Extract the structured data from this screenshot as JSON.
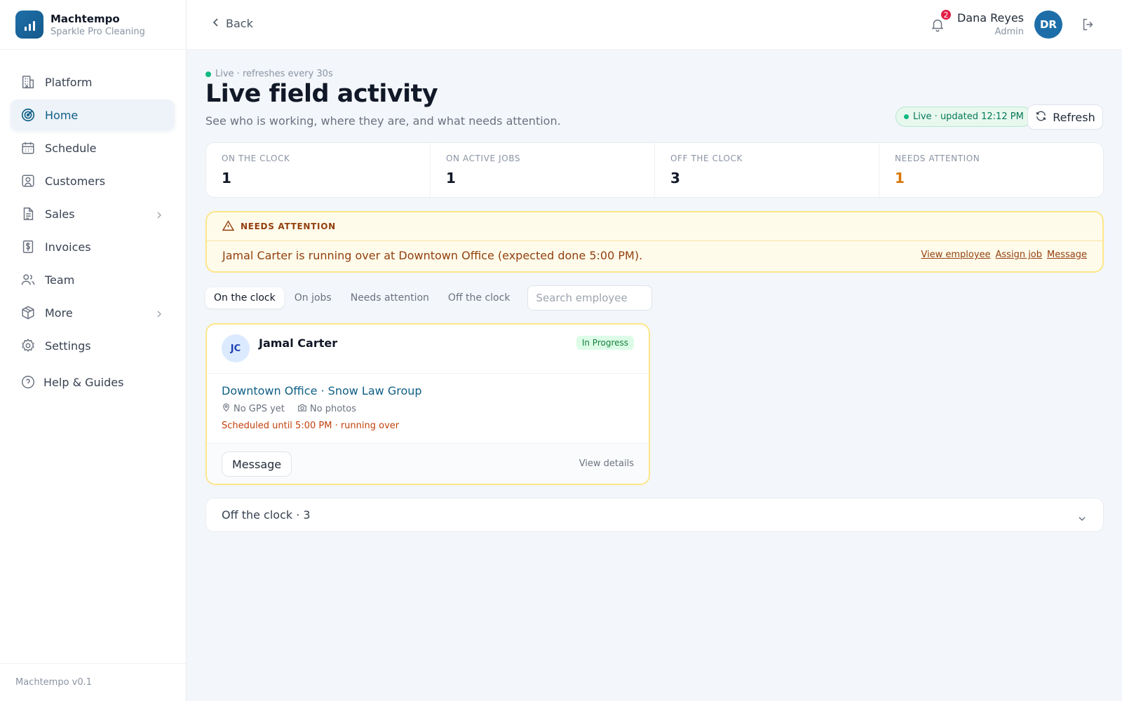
{
  "brand": {
    "name": "Machtempo",
    "subtitle": "Sparkle Pro Cleaning"
  },
  "sidebar": {
    "items": [
      {
        "label": "Platform",
        "icon": "building-icon",
        "active": false
      },
      {
        "label": "Home",
        "icon": "radar-icon",
        "active": true
      },
      {
        "label": "Schedule",
        "icon": "calendar-icon",
        "active": false
      },
      {
        "label": "Customers",
        "icon": "user-square-icon",
        "active": false
      },
      {
        "label": "Sales",
        "icon": "document-icon",
        "active": false,
        "expandable": true
      },
      {
        "label": "Invoices",
        "icon": "dollar-receipt-icon",
        "active": false
      },
      {
        "label": "Team",
        "icon": "users-icon",
        "active": false
      },
      {
        "label": "More",
        "icon": "package-icon",
        "active": false,
        "expandable": true
      },
      {
        "label": "Settings",
        "icon": "gear-icon",
        "active": false
      },
      {
        "label": "Help & Guides",
        "icon": "help-circle-icon",
        "active": false
      }
    ],
    "version": "Machtempo v0.1"
  },
  "header": {
    "back_label": "Back",
    "notifications_count": "2",
    "user_name": "Dana Reyes",
    "user_role": "Admin",
    "user_initials": "DR"
  },
  "page": {
    "live_status": "Live · refreshes every 30s",
    "title": "Live field activity",
    "subtitle": "See who is working, where they are, and what needs attention.",
    "live_pill": "Live · updated 12:12 PM",
    "refresh_label": "Refresh"
  },
  "stats": [
    {
      "label": "ON THE CLOCK",
      "value": "1"
    },
    {
      "label": "ON ACTIVE JOBS",
      "value": "1"
    },
    {
      "label": "OFF THE CLOCK",
      "value": "3"
    },
    {
      "label": "NEEDS ATTENTION",
      "value": "1"
    }
  ],
  "alert": {
    "heading": "NEEDS ATTENTION",
    "message": "Jamal Carter is running over at Downtown Office (expected done 5:00 PM).",
    "links": [
      "View employee",
      "Assign job",
      "Message"
    ]
  },
  "filters": {
    "tabs": [
      "On the clock",
      "On jobs",
      "Needs attention",
      "Off the clock"
    ],
    "active_tab": "On the clock",
    "search_placeholder": "Search employee"
  },
  "employee_card": {
    "initials": "JC",
    "name": "Jamal Carter",
    "status": "In Progress",
    "job": "Downtown Office · Snow Law Group",
    "gps": "No GPS yet",
    "photos": "No photos",
    "schedule_note": "Scheduled until 5:00 PM · running over",
    "message_label": "Message",
    "details_label": "View details"
  },
  "off_clock_section": {
    "label": "Off the clock · 3"
  },
  "colors": {
    "accent": "#0f5e86",
    "brand": "#1d6ea8",
    "warning": "#d97706",
    "success": "#10b981",
    "danger": "#e11d48"
  }
}
